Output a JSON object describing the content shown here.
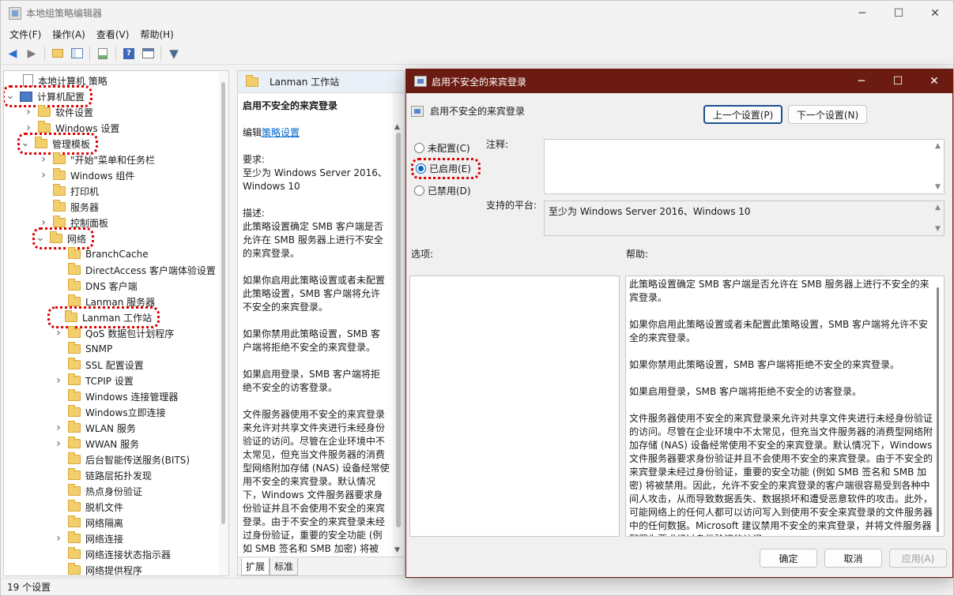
{
  "window": {
    "title": "本地组策略编辑器",
    "minimize": "─",
    "maximize": "☐",
    "close": "✕"
  },
  "menu": [
    "文件(F)",
    "操作(A)",
    "查看(V)",
    "帮助(H)"
  ],
  "toolbar": {
    "back_icon": "arrow-left-icon",
    "forward_icon": "arrow-right-icon",
    "up_icon": "folder-up-icon",
    "show_tree_icon": "console-tree-icon",
    "export_icon": "export-list-icon",
    "help_icon": "help-icon",
    "properties_icon": "properties-icon",
    "filter_icon": "filter-icon"
  },
  "tree": {
    "items": [
      {
        "label": "本地计算机 策略",
        "level": 0,
        "expander": "",
        "icon": "doc",
        "highlight": false
      },
      {
        "label": "计算机配置",
        "level": 0,
        "expander": "v",
        "icon": "pc",
        "highlight": true
      },
      {
        "label": "软件设置",
        "level": 1,
        "expander": ">",
        "icon": "folder",
        "highlight": false
      },
      {
        "label": "Windows 设置",
        "level": 1,
        "expander": ">",
        "icon": "folder",
        "highlight": false
      },
      {
        "label": "管理模板",
        "level": 1,
        "expander": "v",
        "icon": "folder",
        "highlight": true
      },
      {
        "label": "\"开始\"菜单和任务栏",
        "level": 2,
        "expander": ">",
        "icon": "folder",
        "highlight": false
      },
      {
        "label": "Windows 组件",
        "level": 2,
        "expander": ">",
        "icon": "folder",
        "highlight": false
      },
      {
        "label": "打印机",
        "level": 2,
        "expander": "",
        "icon": "folder",
        "highlight": false
      },
      {
        "label": "服务器",
        "level": 2,
        "expander": "",
        "icon": "folder",
        "highlight": false
      },
      {
        "label": "控制面板",
        "level": 2,
        "expander": ">",
        "icon": "folder",
        "highlight": false
      },
      {
        "label": "网络",
        "level": 2,
        "expander": "v",
        "icon": "folder",
        "highlight": true
      },
      {
        "label": "BranchCache",
        "level": 3,
        "expander": "",
        "icon": "folder",
        "highlight": false
      },
      {
        "label": "DirectAccess 客户端体验设置",
        "level": 3,
        "expander": "",
        "icon": "folder",
        "highlight": false
      },
      {
        "label": "DNS 客户端",
        "level": 3,
        "expander": "",
        "icon": "folder",
        "highlight": false
      },
      {
        "label": "Lanman 服务器",
        "level": 3,
        "expander": "",
        "icon": "folder",
        "highlight": false
      },
      {
        "label": "Lanman 工作站",
        "level": 3,
        "expander": "",
        "icon": "folder",
        "highlight": true
      },
      {
        "label": "QoS 数据包计划程序",
        "level": 3,
        "expander": ">",
        "icon": "folder",
        "highlight": false
      },
      {
        "label": "SNMP",
        "level": 3,
        "expander": "",
        "icon": "folder",
        "highlight": false
      },
      {
        "label": "SSL 配置设置",
        "level": 3,
        "expander": "",
        "icon": "folder",
        "highlight": false
      },
      {
        "label": "TCPIP 设置",
        "level": 3,
        "expander": ">",
        "icon": "folder",
        "highlight": false
      },
      {
        "label": "Windows 连接管理器",
        "level": 3,
        "expander": "",
        "icon": "folder",
        "highlight": false
      },
      {
        "label": "Windows立即连接",
        "level": 3,
        "expander": "",
        "icon": "folder",
        "highlight": false
      },
      {
        "label": "WLAN 服务",
        "level": 3,
        "expander": ">",
        "icon": "folder",
        "highlight": false
      },
      {
        "label": "WWAN 服务",
        "level": 3,
        "expander": ">",
        "icon": "folder",
        "highlight": false
      },
      {
        "label": "后台智能传送服务(BITS)",
        "level": 3,
        "expander": "",
        "icon": "folder",
        "highlight": false
      },
      {
        "label": "链路层拓扑发现",
        "level": 3,
        "expander": "",
        "icon": "folder",
        "highlight": false
      },
      {
        "label": "热点身份验证",
        "level": 3,
        "expander": "",
        "icon": "folder",
        "highlight": false
      },
      {
        "label": "脱机文件",
        "level": 3,
        "expander": "",
        "icon": "folder",
        "highlight": false
      },
      {
        "label": "网络隔离",
        "level": 3,
        "expander": "",
        "icon": "folder",
        "highlight": false
      },
      {
        "label": "网络连接",
        "level": 3,
        "expander": ">",
        "icon": "folder",
        "highlight": false
      },
      {
        "label": "网络连接状态指示器",
        "level": 3,
        "expander": "",
        "icon": "folder",
        "highlight": false
      },
      {
        "label": "网络提供程序",
        "level": 3,
        "expander": "",
        "icon": "folder",
        "highlight": false
      }
    ]
  },
  "middle": {
    "header": "Lanman 工作站",
    "setting_title": "启用不安全的来宾登录",
    "edit_prefix": "编辑",
    "edit_link": "策略设置",
    "requirements_label": "要求:",
    "requirements": "至少为 Windows Server 2016、Windows 10",
    "description_label": "描述:",
    "paragraphs": [
      "此策略设置确定 SMB 客户端是否允许在 SMB 服务器上进行不安全的来宾登录。",
      "如果你启用此策略设置或者未配置此策略设置，SMB 客户端将允许不安全的来宾登录。",
      "如果你禁用此策略设置，SMB 客户端将拒绝不安全的来宾登录。",
      "如果启用登录，SMB 客户端将拒绝不安全的访客登录。",
      "文件服务器使用不安全的来宾登录来允许对共享文件夹进行未经身份验证的访问。尽管在企业环境中不太常见，但充当文件服务器的消费型网络附加存储 (NAS) 设备经常使用不安全的来宾登录。默认情况下，Windows 文件服务器要求身份验证并且不会使用不安全的来宾登录。由于不安全的来宾登录未经过身份验证，重要的安全功能 (例如 SMB 签名和 SMB 加密) 将被"
    ],
    "tabs": [
      "扩展",
      "标准"
    ]
  },
  "status": "19 个设置",
  "dialog": {
    "title": "启用不安全的来宾登录",
    "setting_name": "启用不安全的来宾登录",
    "prev_button": "上一个设置(P)",
    "next_button": "下一个设置(N)",
    "radio_not_configured": "未配置(C)",
    "radio_enabled": "已启用(E)",
    "radio_disabled": "已禁用(D)",
    "selected": "enabled",
    "comment_label": "注释:",
    "comment_value": "",
    "platform_label": "支持的平台:",
    "platform_value": "至少为 Windows Server 2016、Windows 10",
    "options_label": "选项:",
    "help_label": "帮助:",
    "help_paragraphs": [
      "此策略设置确定 SMB 客户端是否允许在 SMB 服务器上进行不安全的来宾登录。",
      "如果你启用此策略设置或者未配置此策略设置，SMB 客户端将允许不安全的来宾登录。",
      "如果你禁用此策略设置，SMB 客户端将拒绝不安全的来宾登录。",
      "如果启用登录，SMB 客户端将拒绝不安全的访客登录。",
      "文件服务器使用不安全的来宾登录来允许对共享文件夹进行未经身份验证的访问。尽管在企业环境中不太常见，但充当文件服务器的消费型网络附加存储 (NAS) 设备经常使用不安全的来宾登录。默认情况下，Windows 文件服务器要求身份验证并且不会使用不安全的来宾登录。由于不安全的来宾登录未经过身份验证，重要的安全功能 (例如 SMB 签名和 SMB 加密) 将被禁用。因此，允许不安全的来宾登录的客户端很容易受到各种中间人攻击，从而导致数据丢失、数据损坏和遭受恶意软件的攻击。此外，可能网络上的任何人都可以访问写入到使用不安全来宾登录的文件服务器中的任何数据。Microsoft 建议禁用不安全的来宾登录，并将文件服务器配置为要求经过身份验证的访问。"
    ],
    "ok_button": "确定",
    "cancel_button": "取消",
    "apply_button": "应用(A)"
  },
  "colors": {
    "dialog_titlebar": "#6b1b12",
    "highlight_marker": "#e00000",
    "link": "#0066cc",
    "accent": "#0067c0"
  }
}
